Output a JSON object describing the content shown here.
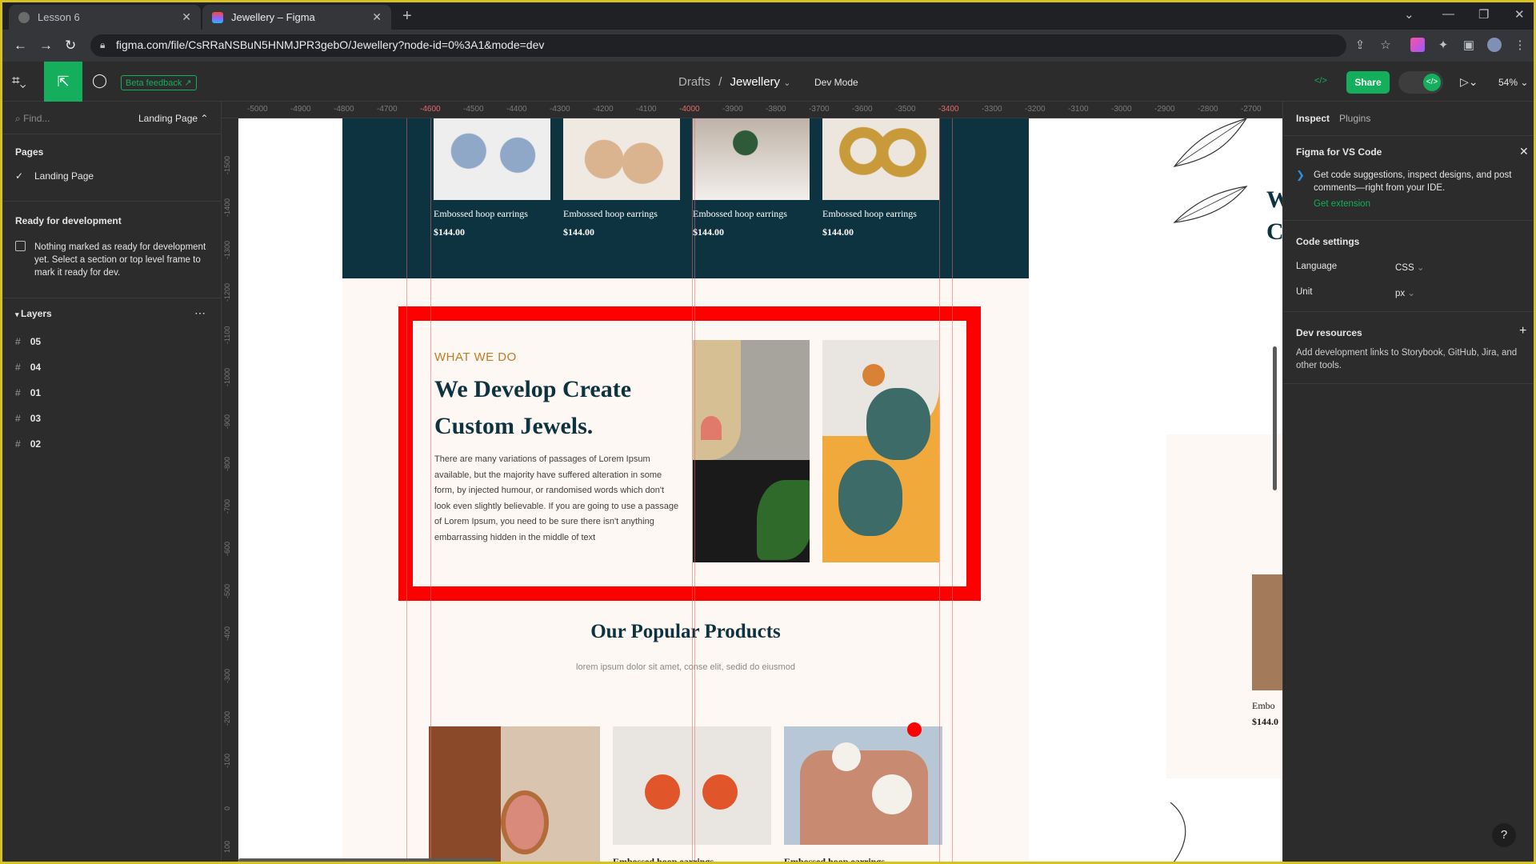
{
  "browser": {
    "tabs": [
      {
        "label": "Lesson 6",
        "active": false
      },
      {
        "label": "Jewellery – Figma",
        "active": true
      }
    ],
    "url": "figma.com/file/CsRRaNSBuN5HNMJPR3gebO/Jewellery?node-id=0%3A1&mode=dev"
  },
  "toolbar": {
    "beta_feedback": "Beta feedback",
    "breadcrumb_drafts": "Drafts",
    "breadcrumb_sep": "/",
    "file_name": "Jewellery",
    "dev_mode": "Dev Mode",
    "share": "Share",
    "zoom": "54%"
  },
  "left_panel": {
    "find_placeholder": "Find...",
    "page_selector": "Landing Page",
    "pages_heading": "Pages",
    "pages": [
      "Landing Page"
    ],
    "ready_heading": "Ready for development",
    "ready_note": "Nothing marked as ready for development yet. Select a section or top level frame to mark it ready for dev.",
    "layers_heading": "Layers",
    "layers": [
      "05",
      "04",
      "01",
      "03",
      "02"
    ]
  },
  "rulers": {
    "horizontal": [
      "-5000",
      "-4900",
      "-4800",
      "-4700",
      "-4600",
      "-4500",
      "-4400",
      "-4300",
      "-4200",
      "-4100",
      "-4000",
      "-3900",
      "-3800",
      "-3700",
      "-3600",
      "-3500",
      "-3400",
      "-3300",
      "-3200",
      "-3100",
      "-3000",
      "-2900",
      "-2800",
      "-2700"
    ],
    "vertical": [
      "-1500",
      "-1400",
      "-1300",
      "-1200",
      "-1100",
      "-1000",
      "-900",
      "-800",
      "-700",
      "-600",
      "-500",
      "-400",
      "-300",
      "-200",
      "-100",
      "0",
      "100"
    ]
  },
  "design": {
    "top_products": [
      {
        "name": "Embossed hoop earrings",
        "price": "$144.00"
      },
      {
        "name": "Embossed hoop earrings",
        "price": "$144.00"
      },
      {
        "name": "Embossed hoop earrings",
        "price": "$144.00"
      },
      {
        "name": "Embossed hoop earrings",
        "price": "$144.00"
      }
    ],
    "what_we_do": {
      "eyebrow": "WHAT WE DO",
      "title": "We Develop Create Custom Jewels.",
      "body": "There are many variations of passages of Lorem Ipsum available, but the majority have suffered alteration in some form, by injected humour, or randomised words which don't look even slightly believable. If you are going to use a passage of Lorem Ipsum, you need to be sure there isn't anything embarrassing hidden in the middle of text"
    },
    "popular": {
      "title": "Our Popular Products",
      "subtitle": "lorem ipsum dolor sit amet, conse elit, sedid do eiusmod"
    },
    "bottom_products": [
      {
        "name": ""
      },
      {
        "name": "Embossed hoop earrings"
      },
      {
        "name": "Embossed hoop earrings"
      }
    ],
    "right_frame": {
      "letters": [
        "W",
        "C"
      ],
      "partial_name": "Embo",
      "partial_price": "$144.0"
    }
  },
  "right_panel": {
    "tabs": [
      "Inspect",
      "Plugins"
    ],
    "vscode_title": "Figma for VS Code",
    "vscode_text": "Get code suggestions, inspect designs, and post comments—right from your IDE.",
    "vscode_link": "Get extension",
    "code_settings": "Code settings",
    "language_label": "Language",
    "language_value": "CSS",
    "unit_label": "Unit",
    "unit_value": "px",
    "dev_resources": "Dev resources",
    "dev_resources_text": "Add development links to Storybook, GitHub, Jira, and other tools."
  },
  "colors": {
    "figma_green": "#14ae5c",
    "dark_teal": "#0e3340",
    "highlight_red": "#ff0000",
    "accent_gold": "#c07a1f"
  }
}
